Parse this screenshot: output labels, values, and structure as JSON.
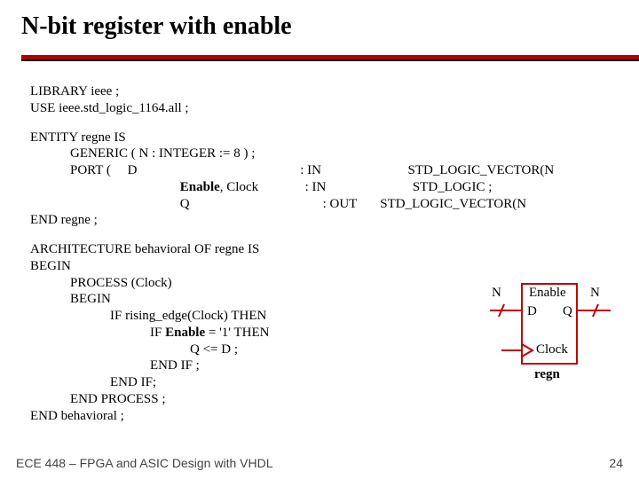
{
  "title": "N-bit register with enable",
  "code": {
    "l1": "LIBRARY ieee ;",
    "l2": "USE ieee.std_logic_1164.all ;",
    "l3": "ENTITY regne IS",
    "l4": "            GENERIC ( N : INTEGER := 8 ) ;",
    "l5": "            PORT (     D                                                 : IN                          STD_LOGIC_VECTOR(N",
    "l6a": "                                             ",
    "l6b": "Enable",
    "l6c": ", Clock              : IN                          STD_LOGIC ;",
    "l7": "                                             Q                                        : OUT       STD_LOGIC_VECTOR(N",
    "l8": "END regne ;",
    "l9": "ARCHITECTURE behavioral OF regne IS",
    "l10": "BEGIN",
    "l11": "            PROCESS (Clock)",
    "l12": "            BEGIN",
    "l13": "                        IF rising_edge(Clock) THEN",
    "l14a": "                                    IF ",
    "l14b": "Enable",
    "l14c": " = '1' THEN",
    "l15": "                                                Q <= D ;",
    "l16": "                                    END IF ;",
    "l17": "                        END IF;",
    "l18": "            END PROCESS ;",
    "l19": "END behavioral ;"
  },
  "diagram": {
    "n_left": "N",
    "n_right": "N",
    "enable": "Enable",
    "d": "D",
    "q": "Q",
    "clock": "Clock",
    "name": "regn"
  },
  "footer": {
    "left": "ECE 448 – FPGA and ASIC Design with VHDL",
    "page": "24"
  }
}
